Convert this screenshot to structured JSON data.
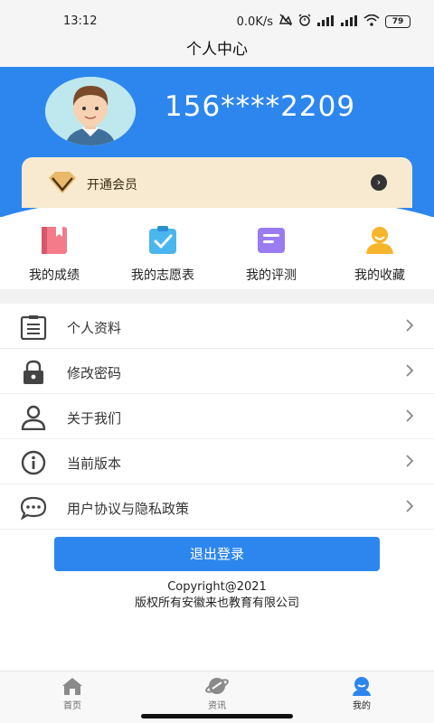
{
  "status_bar": {
    "time": "13:12",
    "net_speed": "0.0K/s",
    "battery": "79"
  },
  "header": {
    "title": "个人中心"
  },
  "profile": {
    "phone": "156****2209"
  },
  "vip": {
    "label": "开通会员"
  },
  "quick": [
    {
      "label": "我的成绩",
      "icon": "book-icon"
    },
    {
      "label": "我的志愿表",
      "icon": "clipboard-check-icon"
    },
    {
      "label": "我的评测",
      "icon": "document-lines-icon"
    },
    {
      "label": "我的收藏",
      "icon": "person-favorite-icon"
    }
  ],
  "menu": [
    {
      "label": "个人资料",
      "icon": "profile-list-icon"
    },
    {
      "label": "修改密码",
      "icon": "lock-icon"
    },
    {
      "label": "关于我们",
      "icon": "user-icon"
    },
    {
      "label": "当前版本",
      "icon": "info-icon"
    },
    {
      "label": "用户协议与隐私政策",
      "icon": "chat-dots-icon"
    }
  ],
  "logout": {
    "label": "退出登录"
  },
  "copyright": {
    "line1": "Copyright@2021",
    "line2": "版权所有安徽来也教育有限公司"
  },
  "tabs": [
    {
      "label": "首页",
      "icon": "home-icon"
    },
    {
      "label": "资讯",
      "icon": "planet-icon"
    },
    {
      "label": "我的",
      "icon": "me-icon"
    }
  ],
  "colors": {
    "primary": "#2d86ee",
    "vip_bg": "#f7ead0"
  }
}
